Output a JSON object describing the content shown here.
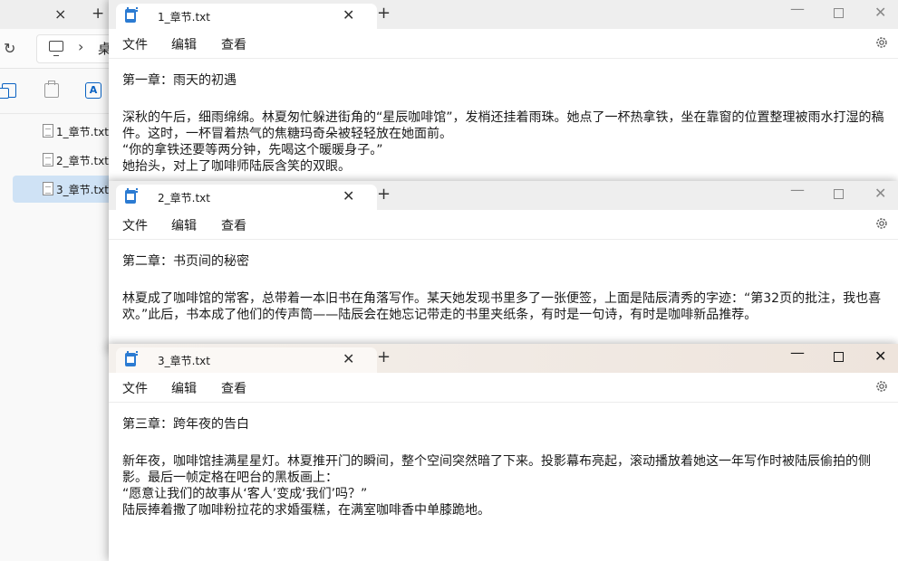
{
  "explorer": {
    "breadcrumb_partial": "桌",
    "files": [
      {
        "name": "1_章节.txt",
        "selected": false
      },
      {
        "name": "2_章节.txt",
        "selected": false
      },
      {
        "name": "3_章节.txt",
        "selected": true
      }
    ],
    "icons": {
      "tab_close": "×",
      "new_tab": "+",
      "refresh": "↻",
      "chevron": "›"
    }
  },
  "notepad_windows": [
    {
      "tab_title": "1_章节.txt",
      "menu": {
        "file": "文件",
        "edit": "编辑",
        "view": "查看"
      },
      "chapter_title": "第一章：雨天的初遇",
      "body": "深秋的午后，细雨绵绵。林夏匆忙躲进街角的“星辰咖啡馆”，发梢还挂着雨珠。她点了一杯热拿铁，坐在靠窗的位置整理被雨水打湿的稿件。这时，一杯冒着热气的焦糖玛奇朵被轻轻放在她面前。\n“你的拿铁还要等两分钟，先喝这个暖暖身子。”\n她抬头，对上了咖啡师陆辰含笑的双眼。"
    },
    {
      "tab_title": "2_章节.txt",
      "menu": {
        "file": "文件",
        "edit": "编辑",
        "view": "查看"
      },
      "chapter_title": "第二章：书页间的秘密",
      "body": "林夏成了咖啡馆的常客，总带着一本旧书在角落写作。某天她发现书里多了一张便签，上面是陆辰清秀的字迹：“第32页的批注，我也喜欢。”此后，书本成了他们的传声筒——陆辰会在她忘记带走的书里夹纸条，有时是一句诗，有时是咖啡新品推荐。"
    },
    {
      "tab_title": "3_章节.txt",
      "menu": {
        "file": "文件",
        "edit": "编辑",
        "view": "查看"
      },
      "chapter_title": "第三章：跨年夜的告白",
      "body": "新年夜，咖啡馆挂满星星灯。林夏推开门的瞬间，整个空间突然暗了下来。投影幕布亮起，滚动播放着她这一年写作时被陆辰偷拍的侧影。最后一帧定格在吧台的黑板画上：\n“愿意让我们的故事从‘客人’变成‘我们’吗？”\n陆辰捧着撒了咖啡粉拉花的求婚蛋糕，在满室咖啡香中单膝跪地。"
    }
  ],
  "window_controls": {
    "minimize": "—",
    "close": "✕",
    "tab_close": "✕",
    "new_tab": "+"
  },
  "colors": {
    "notepad_icon": "#2b7bd2",
    "selection": "#cfe2f5",
    "active_titlebar": "#eee4dc"
  }
}
